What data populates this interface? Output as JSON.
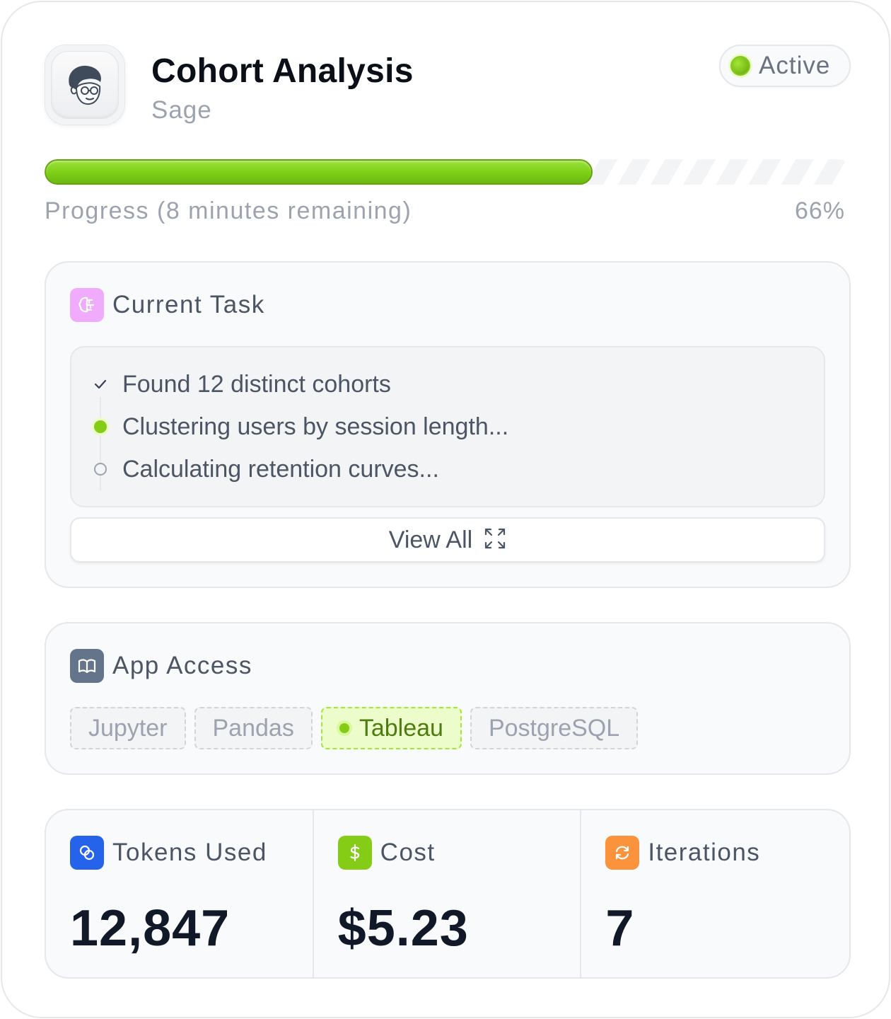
{
  "header": {
    "title": "Cohort Analysis",
    "subtitle": "Sage",
    "status": "Active",
    "avatar_icon": "character-avatar-icon"
  },
  "progress": {
    "label": "Progress (8 minutes remaining)",
    "percent_text": "66%",
    "value": 0.66
  },
  "current_task": {
    "title": "Current Task",
    "icon": "brain-icon",
    "steps": [
      {
        "text": "Found 12 distinct cohorts",
        "state": "done"
      },
      {
        "text": "Clustering users by session length...",
        "state": "active"
      },
      {
        "text": "Calculating retention curves...",
        "state": "pending"
      }
    ],
    "view_all_label": "View All"
  },
  "app_access": {
    "title": "App Access",
    "icon": "book-icon",
    "apps": [
      {
        "label": "Jupyter",
        "active": false
      },
      {
        "label": "Pandas",
        "active": false
      },
      {
        "label": "Tableau",
        "active": true
      },
      {
        "label": "PostgreSQL",
        "active": false
      }
    ]
  },
  "stats": {
    "tokens": {
      "label": "Tokens Used",
      "value": "12,847",
      "icon": "tokens-icon"
    },
    "cost": {
      "label": "Cost",
      "value": "$5.23",
      "icon": "dollar-icon"
    },
    "iterations": {
      "label": "Iterations",
      "value": "7",
      "icon": "refresh-icon"
    }
  },
  "colors": {
    "accent_green": "#84cc16",
    "tokens_blue": "#2563eb",
    "cost_green": "#84cc16",
    "iterations_orange": "#f97316",
    "task_pink": "#e879f9",
    "apps_slate": "#64748b"
  }
}
